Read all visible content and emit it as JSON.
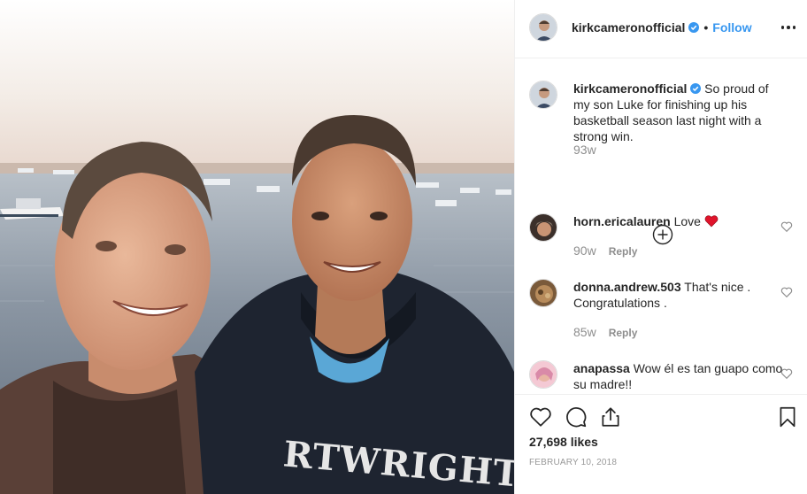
{
  "post": {
    "hoodie_print": "RTWRIGHT'S"
  },
  "header": {
    "username": "kirkcameronofficial",
    "separator": "•",
    "follow_label": "Follow"
  },
  "caption": {
    "username": "kirkcameronofficial",
    "text": "So proud of my son Luke for finishing up his basketball season last night with a strong win.",
    "age": "93w"
  },
  "comments": [
    {
      "username": "horn.ericalauren",
      "text": "Love",
      "emoji": "heart",
      "age": "90w",
      "reply_label": "Reply"
    },
    {
      "username": "donna.andrew.503",
      "text": "That's nice . Congratulations .",
      "age": "85w",
      "reply_label": "Reply"
    },
    {
      "username": "anapassa",
      "text": "Wow él es tan guapo como su madre!!",
      "age": "",
      "reply_label": ""
    }
  ],
  "footer": {
    "likes": "27,698 likes",
    "date": "FEBRUARY 10, 2018"
  },
  "icons": {
    "more": "ellipsis-icon",
    "verified": "verified-badge-icon",
    "load_more": "plus-circle-icon",
    "like": "heart-outline-icon",
    "comment": "speech-bubble-icon",
    "share": "share-icon",
    "save": "bookmark-icon"
  },
  "colors": {
    "accent": "#3897f0",
    "heart_red": "#ed4956",
    "muted": "#8e8e8e",
    "text": "#262626"
  }
}
